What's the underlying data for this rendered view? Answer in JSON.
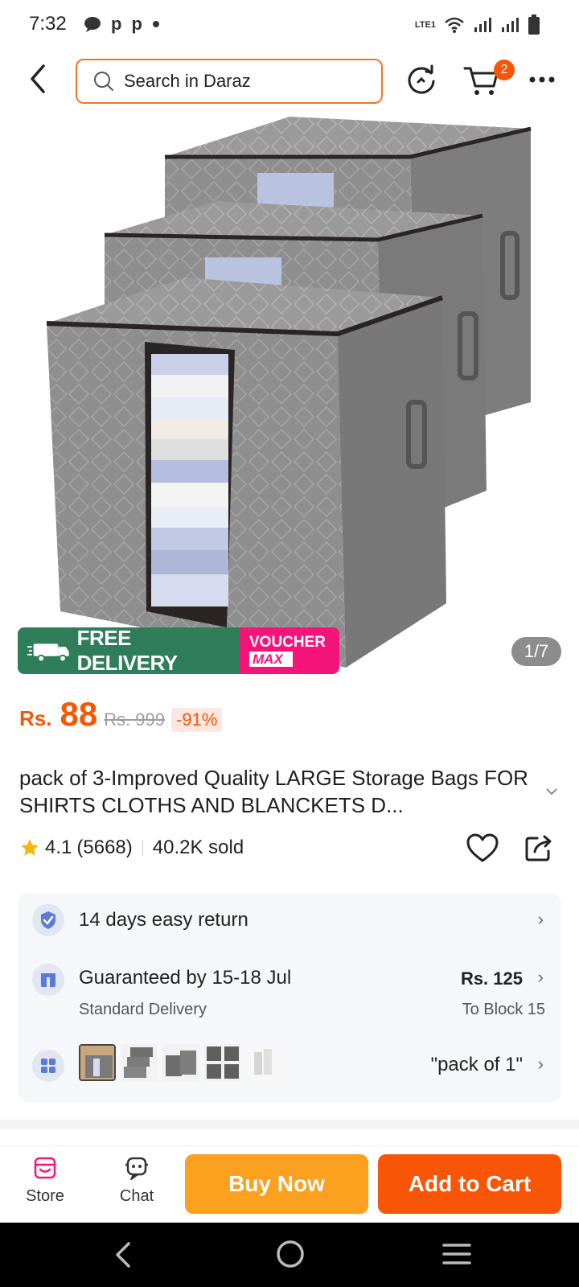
{
  "status_bar": {
    "time": "7:32",
    "notification_letters": [
      "p",
      "p"
    ],
    "network_label": "LTE1"
  },
  "header": {
    "search_placeholder": "Search in Daraz",
    "cart_count": "2",
    "back_icon": "chevron-left-icon",
    "history_icon": "refresh-icon",
    "cart_icon": "cart-icon",
    "more_icon": "more-dots-icon"
  },
  "gallery": {
    "counter": "1/7",
    "free_delivery": "FREE DELIVERY",
    "free_small": "FREE",
    "voucher_line1": "VOUCHER",
    "voucher_line2": "MAX"
  },
  "price": {
    "currency": "Rs.",
    "current": "88",
    "original": "Rs. 999",
    "discount": "-91%"
  },
  "product": {
    "title": "pack of 3-Improved Quality LARGE Storage Bags FOR SHIRTS CLOTHS AND BLANCKETS D...",
    "rating": "4.1",
    "reviews": "(5668)",
    "sold": "40.2K sold"
  },
  "info": {
    "return_text": "14 days easy return",
    "delivery_text": "Guaranteed by 15-18 Jul",
    "delivery_sub": "Standard Delivery",
    "delivery_price": "Rs. 125",
    "delivery_location": "To Block 15",
    "variant_selected": "\"pack of 1\""
  },
  "bottom_bar": {
    "store_label": "Store",
    "chat_label": "Chat",
    "buy_now": "Buy Now",
    "add_to_cart": "Add to Cart"
  },
  "colors": {
    "accent": "#f85606",
    "buy_now": "#fca01f",
    "free_delivery_bg": "#2f7d5b",
    "voucher_bg": "#f5157a",
    "rating_star": "#f7b500"
  }
}
